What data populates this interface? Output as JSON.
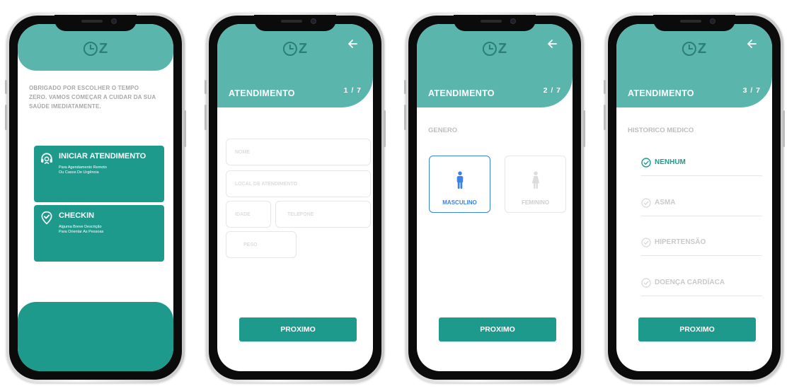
{
  "colors": {
    "teal_dark": "#1e9a8d",
    "teal_light": "#5ab5ad",
    "logo": "#2d7e75",
    "selected_blue": "#3b82e8",
    "muted_gray": "#bdbdbd"
  },
  "logo": {
    "letter": "Z",
    "icon": "clock-icon"
  },
  "screen1": {
    "intro": "OBRIGADO POR ESCOLHER O TEMPO ZERO. VAMOS COMEÇAR A CUIDAR DA SUA SAÚDE IMEDIATAMENTE.",
    "cards": [
      {
        "title": "INICIAR ATENDIMENTO",
        "subtitle_line1": "Para Agendamento Remoto",
        "subtitle_line2": "Ou Casos De Urgência",
        "icon": "headset-icon"
      },
      {
        "title": "CHECKIN",
        "subtitle_line1": "Alguma Breve Descrição",
        "subtitle_line2": "Para Orientar As Pessoas",
        "icon": "location-check-icon"
      }
    ]
  },
  "screen2": {
    "title": "ATENDIMENTO",
    "step": "1 / 7",
    "fields": {
      "nome": "NOME",
      "local": "LOCAL DE ATENDIMENTO",
      "idade": "IDADE",
      "telefone": "TELEFONE",
      "peso": "PESO"
    },
    "button": "PROXIMO"
  },
  "screen3": {
    "title": "ATENDIMENTO",
    "step": "2 / 7",
    "section": "GENERO",
    "options": {
      "male": "MASCULINO",
      "female": "FEMININO"
    },
    "selected": "MASCULINO",
    "button": "PROXIMO"
  },
  "screen4": {
    "title": "ATENDIMENTO",
    "step": "3 / 7",
    "section": "HISTORICO MEDICO",
    "items": [
      {
        "label": "NENHUM",
        "selected": true
      },
      {
        "label": "ASMA",
        "selected": false
      },
      {
        "label": "HIPERTENSÃO",
        "selected": false
      },
      {
        "label": "DOENÇA CARDÍACA",
        "selected": false
      }
    ],
    "button": "PROXIMO"
  }
}
